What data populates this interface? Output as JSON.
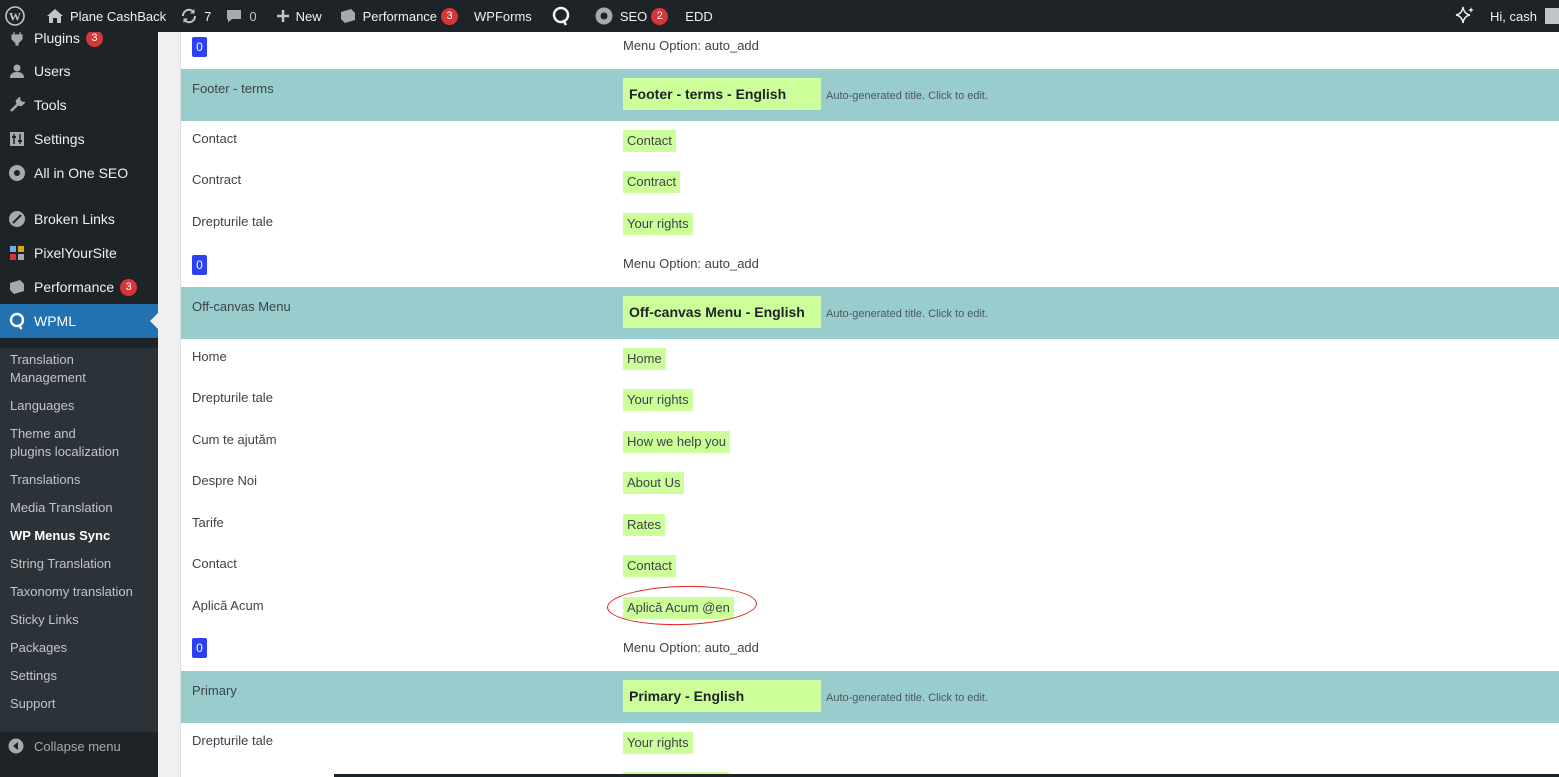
{
  "adminbar": {
    "site_name": "Plane CashBack",
    "updates_count": "7",
    "comments_count": "0",
    "new_label": "New",
    "performance_label": "Performance",
    "performance_badge": "3",
    "wpforms_label": "WPForms",
    "seo_label": "SEO",
    "seo_badge": "2",
    "edd_label": "EDD",
    "greeting": "Hi, cash"
  },
  "sidebar": {
    "items": [
      {
        "label": "Plugins",
        "badge": "3",
        "icon": "plugin-icon"
      },
      {
        "label": "Users",
        "icon": "users-icon"
      },
      {
        "label": "Tools",
        "icon": "wrench-icon"
      },
      {
        "label": "Settings",
        "icon": "settings-icon"
      },
      {
        "label": "All in One SEO",
        "icon": "aioseo-icon"
      },
      {
        "label": "Broken Links",
        "icon": "broken-links-icon"
      },
      {
        "label": "PixelYourSite",
        "icon": "pixelyoursite-icon"
      },
      {
        "label": "Performance",
        "badge": "3",
        "icon": "performance-icon"
      },
      {
        "label": "WPML",
        "icon": "wpml-icon"
      }
    ],
    "submenu": [
      "Translation Management",
      "Languages",
      "Theme and plugins localization",
      "Translations",
      "Media Translation",
      "WP Menus Sync",
      "String Translation",
      "Taxonomy translation",
      "Sticky Links",
      "Packages",
      "Settings",
      "Support"
    ],
    "collapse_label": "Collapse menu"
  },
  "content": {
    "auto_title_hint": "Auto-generated title. Click to edit.",
    "top_option": {
      "badge": "0",
      "option": "Menu Option: auto_add"
    },
    "menus": [
      {
        "name": "Footer - terms",
        "translated_title": "Footer - terms - English",
        "items": [
          {
            "source": "Contact",
            "translation": "Contact"
          },
          {
            "source": "Contract",
            "translation": "Contract"
          },
          {
            "source": "Drepturile tale",
            "translation": "Your rights"
          }
        ],
        "badge": "0",
        "option": "Menu Option: auto_add"
      },
      {
        "name": "Off-canvas Menu",
        "translated_title": "Off-canvas Menu - English",
        "items": [
          {
            "source": "Home",
            "translation": "Home"
          },
          {
            "source": "Drepturile tale",
            "translation": "Your rights"
          },
          {
            "source": "Cum te ajutăm",
            "translation": "How we help you"
          },
          {
            "source": "Despre Noi",
            "translation": "About Us"
          },
          {
            "source": "Tarife",
            "translation": "Rates"
          },
          {
            "source": "Contact",
            "translation": "Contact"
          },
          {
            "source": "Aplică Acum",
            "translation": "Aplică Acum @en"
          }
        ],
        "badge": "0",
        "option": "Menu Option: auto_add"
      },
      {
        "name": "Primary",
        "translated_title": "Primary - English",
        "items": [
          {
            "source": "Drepturile tale",
            "translation": "Your rights"
          }
        ]
      }
    ]
  }
}
